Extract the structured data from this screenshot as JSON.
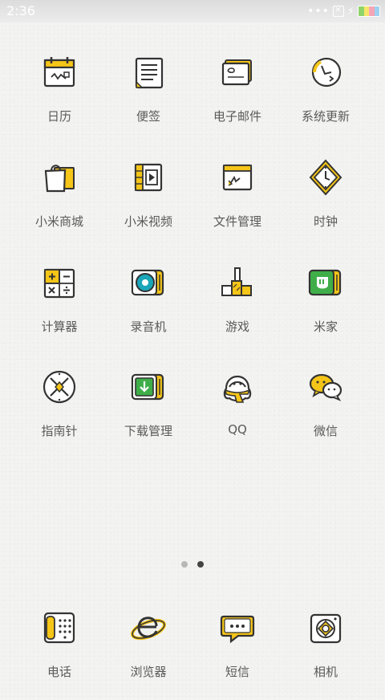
{
  "status": {
    "time": "2:36"
  },
  "colors": {
    "accent_yellow": "#f5c518",
    "icon_stroke": "#333333",
    "green": "#3fae49",
    "teal": "#1aa6b8"
  },
  "apps": [
    {
      "label": "日历",
      "icon": "calendar-icon"
    },
    {
      "label": "便签",
      "icon": "notes-icon"
    },
    {
      "label": "电子邮件",
      "icon": "email-icon"
    },
    {
      "label": "系统更新",
      "icon": "system-update-icon"
    },
    {
      "label": "小米商城",
      "icon": "shopping-bag-icon"
    },
    {
      "label": "小米视频",
      "icon": "video-icon"
    },
    {
      "label": "文件管理",
      "icon": "folder-icon"
    },
    {
      "label": "时钟",
      "icon": "clock-icon"
    },
    {
      "label": "计算器",
      "icon": "calculator-icon"
    },
    {
      "label": "录音机",
      "icon": "recorder-icon"
    },
    {
      "label": "游戏",
      "icon": "game-icon"
    },
    {
      "label": "米家",
      "icon": "mijia-icon"
    },
    {
      "label": "指南针",
      "icon": "compass-icon"
    },
    {
      "label": "下载管理",
      "icon": "download-icon"
    },
    {
      "label": "QQ",
      "icon": "qq-penguin-icon"
    },
    {
      "label": "微信",
      "icon": "wechat-icon"
    }
  ],
  "pager": {
    "pages": 2,
    "active": 2
  },
  "dock": [
    {
      "label": "电话",
      "icon": "phone-icon"
    },
    {
      "label": "浏览器",
      "icon": "browser-icon"
    },
    {
      "label": "短信",
      "icon": "message-icon"
    },
    {
      "label": "相机",
      "icon": "camera-icon"
    }
  ]
}
